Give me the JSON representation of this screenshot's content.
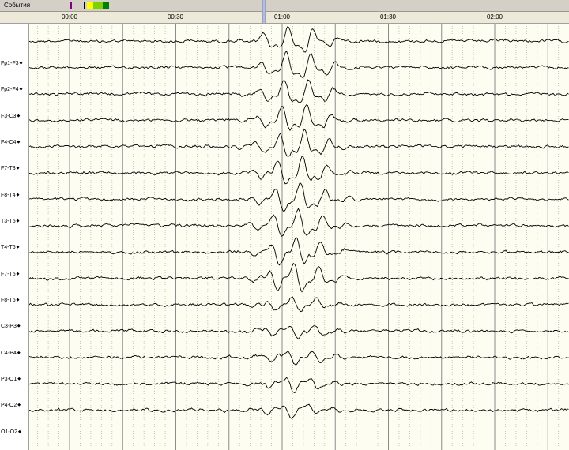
{
  "events_bar": {
    "label": "События",
    "markers": [
      {
        "color": "#800080",
        "x": 0.0
      },
      {
        "color": "#000000",
        "x": 0.25
      },
      {
        "color": "#ffff00",
        "x": 0.35
      },
      {
        "color": "#7fd000",
        "x": 0.6
      },
      {
        "color": "#008000",
        "x": 0.75
      }
    ]
  },
  "time_ruler": {
    "ticks": [
      "00:00",
      "00:30",
      "01:00",
      "01:30",
      "02:00"
    ]
  },
  "channels": [
    "Fp1-F3",
    "Fp2-F4",
    "F3-C3",
    "F4-C4",
    "F7-T3",
    "F8-T4",
    "T3-T5",
    "T4-T6",
    "F7-T5",
    "F8-T6",
    "C3-P3",
    "C4-P4",
    "P3-O1",
    "P4-O2",
    "O1-O2"
  ],
  "colors": {
    "grid_bg": "#fdfdf2",
    "grid_major": "#8c8c8c",
    "grid_minor": "#b8b8a8",
    "trace": "#000000"
  }
}
